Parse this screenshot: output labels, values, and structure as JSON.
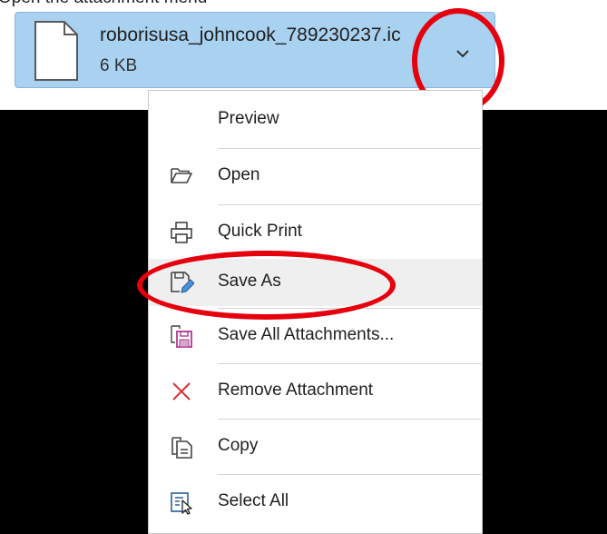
{
  "header": {
    "partial_text": "Open the attachment menu"
  },
  "attachment": {
    "file_name": "roborisusa_johncook_789230237.ic",
    "file_size": "6 KB"
  },
  "menu": {
    "items": [
      {
        "label": "Preview",
        "icon": "none"
      },
      {
        "label": "Open",
        "icon": "folder-open-icon"
      },
      {
        "label": "Quick Print",
        "icon": "printer-icon"
      },
      {
        "label": "Save As",
        "icon": "save-as-icon"
      },
      {
        "label": "Save All Attachments...",
        "icon": "save-all-icon"
      },
      {
        "label": "Remove Attachment",
        "icon": "close-icon"
      },
      {
        "label": "Copy",
        "icon": "copy-icon"
      },
      {
        "label": "Select All",
        "icon": "select-all-icon"
      }
    ]
  },
  "colors": {
    "attachment_bg": "#a9d1f0",
    "annotation": "#e6000e",
    "remove_icon": "#d13438",
    "hover_bg": "#efefef"
  }
}
